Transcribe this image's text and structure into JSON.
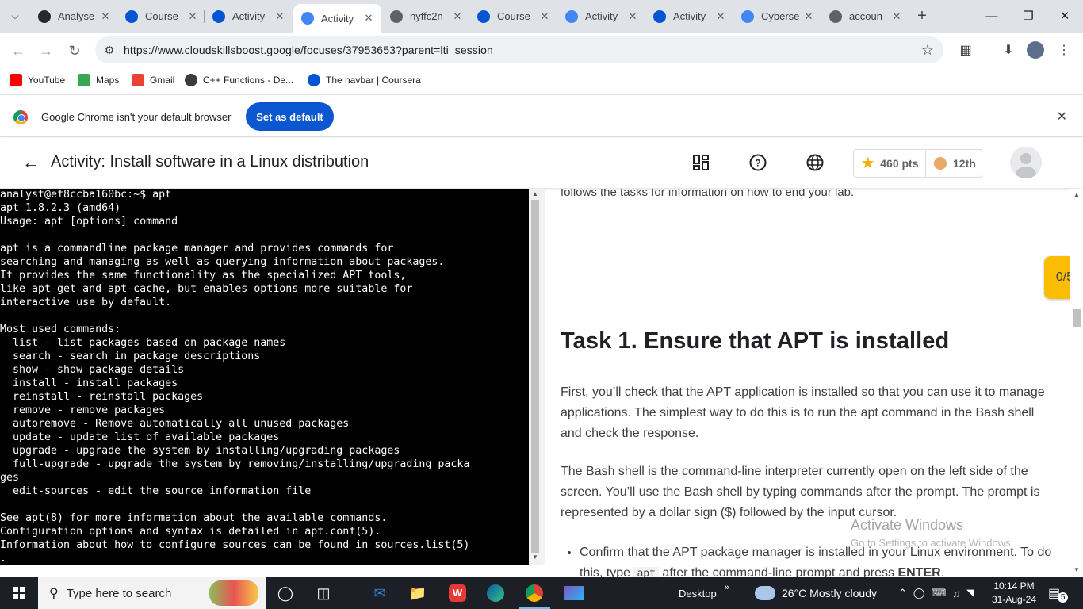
{
  "browser": {
    "tabs": [
      {
        "title": "Analyse",
        "icon": "github-icon",
        "color": "#24292f"
      },
      {
        "title": "Course",
        "icon": "coursera-icon",
        "color": "#0056d2"
      },
      {
        "title": "Activity",
        "icon": "coursera-icon",
        "color": "#0056d2"
      },
      {
        "title": "Activity",
        "icon": "cloud-skills-icon",
        "color": "#4285f4",
        "active": true
      },
      {
        "title": "nyffc2n",
        "icon": "link-icon",
        "color": "#5f6368"
      },
      {
        "title": "Course",
        "icon": "coursera-icon",
        "color": "#0056d2"
      },
      {
        "title": "Activity",
        "icon": "cloud-skills-icon",
        "color": "#4285f4"
      },
      {
        "title": "Activity",
        "icon": "coursera-icon",
        "color": "#0056d2"
      },
      {
        "title": "Cyberse",
        "icon": "docs-icon",
        "color": "#4285f4"
      },
      {
        "title": "accoun",
        "icon": "globe-icon",
        "color": "#5f6368"
      }
    ],
    "url": "https://www.cloudskillsboost.google/focuses/37953653?parent=lti_session",
    "bookmarks": [
      {
        "label": "YouTube",
        "icon": "youtube-icon",
        "color": "#ff0000"
      },
      {
        "label": "Maps",
        "icon": "maps-icon",
        "color": "#34a853"
      },
      {
        "label": "Gmail",
        "icon": "gmail-icon",
        "color": "#ea4335"
      },
      {
        "label": "C++ Functions - De...",
        "icon": "studytonight-icon",
        "color": "#3c3c3c"
      },
      {
        "label": "The navbar | Coursera",
        "icon": "coursera-icon",
        "color": "#0056d2"
      }
    ],
    "infobar": {
      "message": "Google Chrome isn't your default browser",
      "button": "Set as default"
    }
  },
  "lab": {
    "title": "Activity: Install software in a Linux distribution",
    "points": "460 pts",
    "rank": "12th",
    "progress": "0/5",
    "accent": "#fbbc04"
  },
  "terminal": {
    "lines": [
      "analyst@ef8ccba160bc:~$ apt",
      "apt 1.8.2.3 (amd64)",
      "Usage: apt [options] command",
      "",
      "apt is a commandline package manager and provides commands for",
      "searching and managing as well as querying information about packages.",
      "It provides the same functionality as the specialized APT tools,",
      "like apt-get and apt-cache, but enables options more suitable for",
      "interactive use by default.",
      "",
      "Most used commands:",
      "  list - list packages based on package names",
      "  search - search in package descriptions",
      "  show - show package details",
      "  install - install packages",
      "  reinstall - reinstall packages",
      "  remove - remove packages",
      "  autoremove - Remove automatically all unused packages",
      "  update - update list of available packages",
      "  upgrade - upgrade the system by installing/upgrading packages",
      "  full-upgrade - upgrade the system by removing/installing/upgrading packa",
      "ges",
      "  edit-sources - edit the source information file",
      "",
      "See apt(8) for more information about the available commands.",
      "Configuration options and syntax is detailed in apt.conf(5).",
      "Information about how to configure sources can be found in sources.list(5)",
      "."
    ]
  },
  "instructions": {
    "cut_line": "follows the tasks for information on how to end your lab.",
    "heading": "Task 1. Ensure that APT is installed",
    "para1": "First, you’ll check that the APT application is installed so that you can use it to manage applications. The simplest way to do this is to run the apt command in the Bash shell and check the response.",
    "para2": "The Bash shell is the command-line interpreter currently open on the left side of the screen. You’ll use the Bash shell by typing commands after the prompt. The prompt is represented by a dollar sign ($) followed by the input cursor.",
    "bullet_a": "Confirm that the APT package manager is installed in your Linux environment. To do this, type ",
    "bullet_code": "apt",
    "bullet_b": " after the command-line prompt and press ",
    "bullet_strong": "ENTER",
    "bullet_end": "."
  },
  "watermark": {
    "line1": "Activate Windows",
    "line2": "Go to Settings to activate Windows."
  },
  "taskbar": {
    "search_placeholder": "Type here to search",
    "desktop_label": "Desktop",
    "weather": "26°C  Mostly cloudy",
    "time": "10:14 PM",
    "date": "31-Aug-24",
    "notification_count": "5"
  }
}
